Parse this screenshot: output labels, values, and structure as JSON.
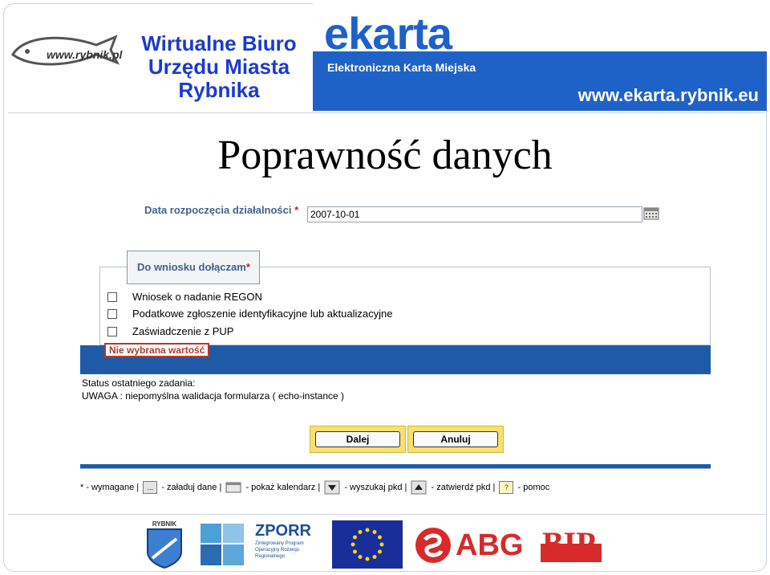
{
  "header": {
    "office_title": "Wirtualne Biuro Urzędu Miasta Rybnika",
    "logo_text": "www.rybnik.pl",
    "ekarta_logo": "ekarta",
    "ekarta_subtitle": "Elektroniczna Karta Miejska",
    "ekarta_url": "www.ekarta.rybnik.eu"
  },
  "slide_title": "Poprawność danych",
  "form": {
    "date_label": "Data rozpoczęcia działalności",
    "required_star": "*",
    "date_value": "2007-10-01",
    "attachments_legend": "Do wniosku dołączam",
    "attachments": [
      {
        "label": "Wniosek o nadanie REGON",
        "checked": false
      },
      {
        "label": "Podatkowe zgłoszenie identyfikacyjne lub aktualizacyjne",
        "checked": false
      },
      {
        "label": "Zaświadczenie z PUP",
        "checked": false
      }
    ],
    "error_message": "Nie wybrana wartość",
    "status_label": "Status ostatniego zadania:",
    "status_message": "UWAGA : niepomyślna walidacja formularza ( echo-instance )",
    "next_button": "Dalej",
    "cancel_button": "Anuluj"
  },
  "legend": {
    "required": "* - wymagane |",
    "load_icon": "...",
    "load": "- załaduj dane |",
    "calendar": "- pokaż kalendarz |",
    "search": "- wyszukaj pkd |",
    "confirm": "- zatwierdź pkd |",
    "help_icon": "?",
    "help": "- pomoc"
  },
  "footer": {
    "rybnik_crest": "RYBNIK",
    "zporr": "ZPORR",
    "zporr_sub": "Zintegrowany Program Operacyjny Rozwoju Regionalnego",
    "abg": "ABG",
    "bip": "BIP"
  },
  "colors": {
    "title_blue": "#1a3bd0",
    "banner_blue": "#1e62c8",
    "bar_blue": "#1e5aa8",
    "error_red": "#b23a2a",
    "button_yellow": "#f7e070"
  }
}
